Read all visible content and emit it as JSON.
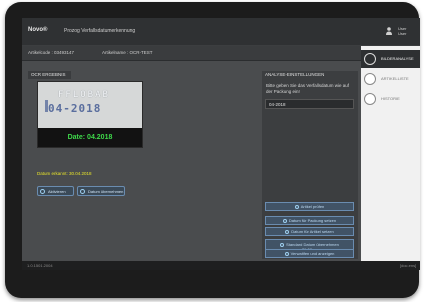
{
  "titlebar": {
    "logo": "Novo®",
    "title": "Prozog Verfallsdatumerkennung",
    "user_line1": "User",
    "user_line2": "User"
  },
  "infobar": {
    "article_code": "Artikelcode : 03493147",
    "article_name": "Artikelname : OCR-TEST"
  },
  "ocr": {
    "header": "OCR ERGEBNIS",
    "image_line1": "FFLOBAB",
    "image_line2": "04-2018",
    "image_date": "Date: 04.2018",
    "recognized": "Datum erkannt: 30.04.2018",
    "btn_refresh": "Aktivieren",
    "btn_accept": "Datum übernehmen"
  },
  "analysis": {
    "header": "ANALYSE-EINSTELLUNGEN",
    "prompt": "Bitte geben Sie das Verfallsdatum wie auf der Packung ein!",
    "value": "04-2018",
    "btn_check": "Artikel prüfen",
    "btn_pack_date": "Datum für Packung setzen",
    "btn_article_date": "Datum für Artikel setzen",
    "btn_standard_line1": "Standard Datum übernehmen",
    "btn_standard_line2": "31.08.yy",
    "btn_show": "Verwaltfen und anzeigen"
  },
  "sidebar": {
    "items": [
      {
        "label": "BILDERANALYSE",
        "icon": "image-analysis-icon"
      },
      {
        "label": "ARTIKELLISTE",
        "icon": "list-icon"
      },
      {
        "label": "HISTORIE",
        "icon": "clock-icon"
      }
    ]
  },
  "statusbar": {
    "version": "1.0.1501.2004",
    "right": "[doc.ens]"
  },
  "colors": {
    "accent_green": "#3ed84a",
    "accent_yellow": "#e7e32a",
    "button_blue": "#415366"
  }
}
